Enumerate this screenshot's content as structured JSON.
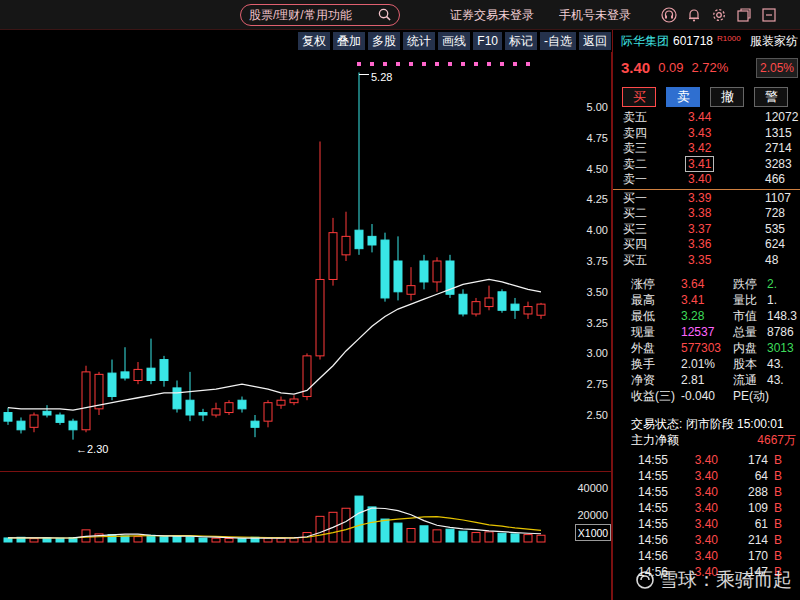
{
  "top_bar": {
    "search": {
      "placeholder": "股票/理财/常用功能"
    },
    "links": [
      "证券交易未登录",
      "手机号未登录"
    ]
  },
  "toolbar": {
    "buttons": [
      "复权",
      "叠加",
      "多股",
      "统计",
      "画线",
      "F10",
      "标记",
      "-自选",
      "返回"
    ]
  },
  "chart": {
    "price_ticks": [
      {
        "label": "5.00",
        "value": 5.0
      },
      {
        "label": "4.75",
        "value": 4.75
      },
      {
        "label": "4.50",
        "value": 4.5
      },
      {
        "label": "4.25",
        "value": 4.25
      },
      {
        "label": "4.00",
        "value": 4.0
      },
      {
        "label": "3.75",
        "value": 3.75
      },
      {
        "label": "3.50",
        "value": 3.5
      },
      {
        "label": "3.25",
        "value": 3.25
      },
      {
        "label": "3.00",
        "value": 3.0
      },
      {
        "label": "2.75",
        "value": 2.75
      },
      {
        "label": "2.50",
        "value": 2.5
      }
    ],
    "high_label": "5.28",
    "low_label": "←2.30",
    "candles": [
      {
        "o": 2.52,
        "h": 2.56,
        "l": 2.42,
        "c": 2.45,
        "marker": false
      },
      {
        "o": 2.45,
        "h": 2.48,
        "l": 2.35,
        "c": 2.38,
        "marker": false
      },
      {
        "o": 2.4,
        "h": 2.52,
        "l": 2.36,
        "c": 2.5,
        "marker": false
      },
      {
        "o": 2.53,
        "h": 2.58,
        "l": 2.48,
        "c": 2.5,
        "marker": false
      },
      {
        "o": 2.5,
        "h": 2.52,
        "l": 2.42,
        "c": 2.44,
        "marker": false
      },
      {
        "o": 2.45,
        "h": 2.47,
        "l": 2.3,
        "c": 2.38,
        "marker": false
      },
      {
        "o": 2.38,
        "h": 2.9,
        "l": 2.36,
        "c": 2.85,
        "marker": false
      },
      {
        "o": 2.55,
        "h": 2.85,
        "l": 2.5,
        "c": 2.83,
        "marker": false
      },
      {
        "o": 2.84,
        "h": 2.95,
        "l": 2.62,
        "c": 2.65,
        "marker": false
      },
      {
        "o": 2.85,
        "h": 3.05,
        "l": 2.78,
        "c": 2.8,
        "marker": false
      },
      {
        "o": 2.78,
        "h": 2.93,
        "l": 2.75,
        "c": 2.87,
        "marker": false
      },
      {
        "o": 2.88,
        "h": 3.12,
        "l": 2.75,
        "c": 2.78,
        "marker": false
      },
      {
        "o": 2.95,
        "h": 2.98,
        "l": 2.73,
        "c": 2.78,
        "marker": false
      },
      {
        "o": 2.72,
        "h": 2.78,
        "l": 2.52,
        "c": 2.55,
        "marker": false
      },
      {
        "o": 2.62,
        "h": 2.85,
        "l": 2.45,
        "c": 2.5,
        "marker": false
      },
      {
        "o": 2.52,
        "h": 2.55,
        "l": 2.45,
        "c": 2.5,
        "marker": false
      },
      {
        "o": 2.5,
        "h": 2.6,
        "l": 2.48,
        "c": 2.55,
        "marker": false
      },
      {
        "o": 2.52,
        "h": 2.62,
        "l": 2.5,
        "c": 2.6,
        "marker": false
      },
      {
        "o": 2.62,
        "h": 2.65,
        "l": 2.52,
        "c": 2.55,
        "marker": false
      },
      {
        "o": 2.45,
        "h": 2.5,
        "l": 2.32,
        "c": 2.4,
        "marker": false
      },
      {
        "o": 2.45,
        "h": 2.62,
        "l": 2.4,
        "c": 2.6,
        "marker": false
      },
      {
        "o": 2.58,
        "h": 2.65,
        "l": 2.55,
        "c": 2.62,
        "marker": false
      },
      {
        "o": 2.6,
        "h": 2.66,
        "l": 2.58,
        "c": 2.63,
        "marker": false
      },
      {
        "o": 2.65,
        "h": 3.0,
        "l": 2.62,
        "c": 2.98,
        "marker": false
      },
      {
        "o": 2.98,
        "h": 4.72,
        "l": 2.95,
        "c": 3.6,
        "marker": false
      },
      {
        "o": 3.6,
        "h": 4.1,
        "l": 3.55,
        "c": 3.98,
        "marker": false
      },
      {
        "o": 3.8,
        "h": 4.15,
        "l": 3.75,
        "c": 3.95,
        "marker": false
      },
      {
        "o": 4.0,
        "h": 5.28,
        "l": 3.8,
        "c": 3.85,
        "marker": true
      },
      {
        "o": 3.95,
        "h": 4.05,
        "l": 3.82,
        "c": 3.88,
        "marker": true
      },
      {
        "o": 3.92,
        "h": 3.98,
        "l": 3.42,
        "c": 3.45,
        "marker": true
      },
      {
        "o": 3.75,
        "h": 3.95,
        "l": 3.43,
        "c": 3.5,
        "marker": true
      },
      {
        "o": 3.48,
        "h": 3.7,
        "l": 3.43,
        "c": 3.55,
        "marker": true
      },
      {
        "o": 3.75,
        "h": 3.8,
        "l": 3.52,
        "c": 3.58,
        "marker": true
      },
      {
        "o": 3.58,
        "h": 3.78,
        "l": 3.5,
        "c": 3.75,
        "marker": true
      },
      {
        "o": 3.75,
        "h": 3.8,
        "l": 3.45,
        "c": 3.48,
        "marker": true
      },
      {
        "o": 3.48,
        "h": 3.52,
        "l": 3.3,
        "c": 3.32,
        "marker": true
      },
      {
        "o": 3.32,
        "h": 3.45,
        "l": 3.3,
        "c": 3.42,
        "marker": true
      },
      {
        "o": 3.38,
        "h": 3.55,
        "l": 3.35,
        "c": 3.45,
        "marker": true
      },
      {
        "o": 3.5,
        "h": 3.52,
        "l": 3.33,
        "c": 3.35,
        "marker": true
      },
      {
        "o": 3.4,
        "h": 3.45,
        "l": 3.28,
        "c": 3.35,
        "marker": true
      },
      {
        "o": 3.32,
        "h": 3.42,
        "l": 3.28,
        "c": 3.38,
        "marker": true
      },
      {
        "o": 3.31,
        "h": 3.41,
        "l": 3.28,
        "c": 3.4,
        "marker": false
      }
    ],
    "ma": [
      2.56,
      2.55,
      2.55,
      2.55,
      2.55,
      2.54,
      2.56,
      2.58,
      2.6,
      2.62,
      2.64,
      2.66,
      2.68,
      2.68,
      2.69,
      2.7,
      2.71,
      2.73,
      2.75,
      2.73,
      2.71,
      2.68,
      2.67,
      2.7,
      2.8,
      2.9,
      3.02,
      3.12,
      3.22,
      3.3,
      3.36,
      3.4,
      3.44,
      3.48,
      3.52,
      3.56,
      3.58,
      3.6,
      3.58,
      3.55,
      3.52,
      3.5
    ]
  },
  "volume": {
    "ticks": [
      {
        "label": "40000",
        "value": 40000
      },
      {
        "label": "20000",
        "value": 20000
      }
    ],
    "unit": "X1000",
    "bars": [
      3000,
      3500,
      2500,
      3000,
      2800,
      3200,
      9000,
      6000,
      5500,
      4500,
      4000,
      5000,
      4000,
      4500,
      3800,
      3000,
      2800,
      2600,
      2500,
      3500,
      3000,
      2800,
      3200,
      7000,
      19000,
      22000,
      25000,
      34000,
      26000,
      17000,
      14000,
      10000,
      12000,
      9000,
      9500,
      8000,
      7000,
      7500,
      6500,
      6000,
      5500,
      5000
    ],
    "ma5": [
      3000,
      3100,
      3000,
      3000,
      2950,
      3000,
      4200,
      4700,
      5300,
      5900,
      5800,
      5000,
      4600,
      4400,
      4300,
      3900,
      3600,
      3300,
      2900,
      2900,
      2900,
      2900,
      3000,
      3900,
      7000,
      10800,
      15200,
      21400,
      25200,
      24800,
      23200,
      20200,
      15800,
      12400,
      10900,
      9700,
      9100,
      8200,
      7700,
      7000,
      6500,
      6100
    ],
    "ma10": [
      3000,
      3050,
      3000,
      3000,
      2960,
      3000,
      3570,
      3880,
      4160,
      4400,
      4500,
      4650,
      4600,
      4800,
      4750,
      4450,
      4150,
      3800,
      3600,
      3500,
      3300,
      3200,
      3100,
      3500,
      5100,
      7000,
      9200,
      12300,
      14600,
      16000,
      17000,
      17700,
      18600,
      18800,
      17700,
      16300,
      14500,
      12700,
      11700,
      10400,
      9500,
      8600
    ]
  },
  "quote": {
    "name": "际华集团",
    "code": "601718",
    "tag": "R1000",
    "sector": "服装家纺",
    "price": "3.40",
    "change": "0.09",
    "pct": "2.72%",
    "badge": "2.05%",
    "actions": [
      {
        "label": "买",
        "selected": false,
        "color": "#ff4a4a"
      },
      {
        "label": "卖",
        "selected": true,
        "color": "#ffffff"
      },
      {
        "label": "撤",
        "selected": false,
        "color": "#ffffff"
      },
      {
        "label": "警",
        "selected": false,
        "color": "#ffffff"
      }
    ],
    "asks": [
      {
        "label": "卖五",
        "price": "3.44",
        "volume": "12072",
        "selected": false
      },
      {
        "label": "卖四",
        "price": "3.43",
        "volume": "1315",
        "selected": false
      },
      {
        "label": "卖三",
        "price": "3.42",
        "volume": "2714",
        "selected": false
      },
      {
        "label": "卖二",
        "price": "3.41",
        "volume": "3283",
        "selected": true
      },
      {
        "label": "卖一",
        "price": "3.40",
        "volume": "466",
        "selected": false
      }
    ],
    "bids": [
      {
        "label": "买一",
        "price": "3.39",
        "volume": "1107",
        "selected": false
      },
      {
        "label": "买二",
        "price": "3.38",
        "volume": "728",
        "selected": false
      },
      {
        "label": "买三",
        "price": "3.37",
        "volume": "535",
        "selected": false
      },
      {
        "label": "买四",
        "price": "3.36",
        "volume": "624",
        "selected": false
      },
      {
        "label": "买五",
        "price": "3.35",
        "volume": "48",
        "selected": false
      }
    ],
    "stats": [
      {
        "label": "涨停",
        "value": "3.64",
        "color": "#ff4a4a",
        "label2": "跌停",
        "value2": "2.",
        "color2": "#3ddc5a"
      },
      {
        "label": "最高",
        "value": "3.41",
        "color": "#ff4a4a",
        "label2": "量比",
        "value2": "1.",
        "color2": "#e8e8e8"
      },
      {
        "label": "最低",
        "value": "3.28",
        "color": "#3ddc5a",
        "label2": "市值",
        "value2": "148.3",
        "color2": "#e8e8e8"
      },
      {
        "label": "现量",
        "value": "12537",
        "color": "#ff66ff",
        "label2": "总量",
        "value2": "8786",
        "color2": "#e8e8e8"
      },
      {
        "label": "外盘",
        "value": "577303",
        "color": "#ff4a4a",
        "label2": "内盘",
        "value2": "3013",
        "color2": "#3ddc5a"
      },
      {
        "label": "换手",
        "value": "2.01%",
        "color": "#e8e8e8",
        "label2": "股本",
        "value2": "43.",
        "color2": "#e8e8e8"
      },
      {
        "label": "净资",
        "value": "2.81",
        "color": "#e8e8e8",
        "label2": "流通",
        "value2": "43.",
        "color2": "#e8e8e8"
      },
      {
        "label": "收益(三)",
        "value": "-0.040",
        "color": "#e8e8e8",
        "label2": "PE(动)"
      }
    ],
    "status": "交易状态: 闭市阶段 15:00:01",
    "flow": {
      "label": "主力净额",
      "value": "4667万"
    },
    "ticks": [
      {
        "time": "14:55",
        "price": "3.40",
        "volume": "174",
        "side": "B"
      },
      {
        "time": "14:55",
        "price": "3.40",
        "volume": "64",
        "side": "B"
      },
      {
        "time": "14:55",
        "price": "3.40",
        "volume": "288",
        "side": "B"
      },
      {
        "time": "14:55",
        "price": "3.40",
        "volume": "109",
        "side": "B"
      },
      {
        "time": "14:55",
        "price": "3.40",
        "volume": "61",
        "side": "B"
      },
      {
        "time": "14:56",
        "price": "3.40",
        "volume": "214",
        "side": "B"
      },
      {
        "time": "14:56",
        "price": "3.40",
        "volume": "170",
        "side": "B"
      },
      {
        "time": "14:56",
        "price": "3.40",
        "volume": "147",
        "side": "B"
      }
    ]
  },
  "watermark": "雪球：乘骑而起"
}
